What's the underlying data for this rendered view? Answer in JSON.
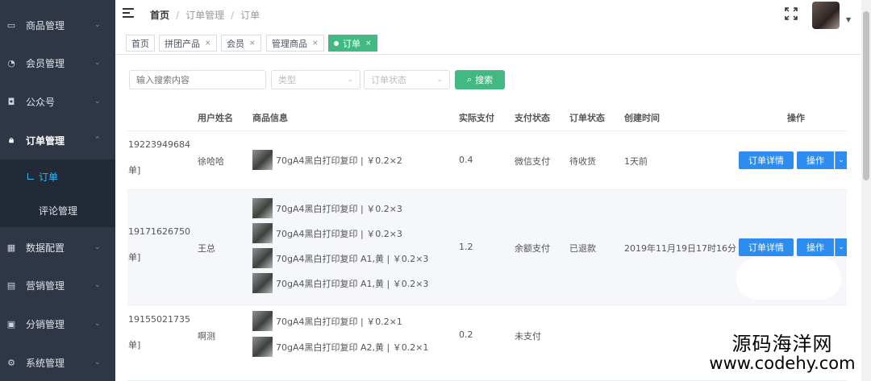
{
  "sidebar": {
    "items": [
      {
        "label": "商品管理",
        "icon": "bag-icon"
      },
      {
        "label": "会员管理",
        "icon": "user-icon"
      },
      {
        "label": "公众号",
        "icon": "wechat-icon"
      },
      {
        "label": "订单管理",
        "icon": "lock-icon"
      },
      {
        "label": "数据配置",
        "icon": "grid-icon"
      },
      {
        "label": "营销管理",
        "icon": "marketing-icon"
      },
      {
        "label": "分销管理",
        "icon": "distribution-icon"
      },
      {
        "label": "系统管理",
        "icon": "gear-icon"
      }
    ],
    "submenu": [
      {
        "label": "订单"
      },
      {
        "label": "评论管理"
      }
    ]
  },
  "header": {
    "breadcrumb": [
      "首页",
      "订单管理",
      "订单"
    ]
  },
  "tabs": [
    {
      "label": "首页"
    },
    {
      "label": "拼团产品"
    },
    {
      "label": "会员"
    },
    {
      "label": "管理商品"
    },
    {
      "label": "订单"
    }
  ],
  "filters": {
    "search_placeholder": "输入搜索内容",
    "type_placeholder": "类型",
    "status_placeholder": "订单状态",
    "search_button": "搜索"
  },
  "table": {
    "headers": [
      "用户姓名",
      "商品信息",
      "实际支付",
      "支付状态",
      "订单状态",
      "创建时间",
      "操作"
    ],
    "rows": [
      {
        "order_id": "19223949684",
        "order_suffix": "单]",
        "user": "徐哈哈",
        "goods": [
          "70gA4黑白打印复印 | ￥0.2×2"
        ],
        "paid": "0.4",
        "pay_status": "微信支付",
        "order_status": "待收货",
        "created": "1天前",
        "detail_btn": "订单详情",
        "op_btn": "操作"
      },
      {
        "order_id": "19171626750",
        "order_suffix": "单]",
        "user": "王总",
        "goods": [
          "70gA4黑白打印复印 | ￥0.2×3",
          "70gA4黑白打印复印 | ￥0.2×3",
          "70gA4黑白打印复印 A1,黄 | ￥0.2×3",
          "70gA4黑白打印复印 A1,黄 | ￥0.2×3"
        ],
        "paid": "1.2",
        "pay_status": "余额支付",
        "order_status": "已退款",
        "created": "2019年11月19日17时16分",
        "detail_btn": "订单详情",
        "op_btn": "操作"
      },
      {
        "order_id": "19155021735",
        "order_suffix": "单]",
        "user": "啊测",
        "goods": [
          "70gA4黑白打印复印 | ￥0.2×1",
          "70gA4黑白打印复印 A2,黄 | ￥0.2×1"
        ],
        "paid": "0.2",
        "pay_status": "未支付",
        "order_status": "",
        "created": ""
      }
    ]
  },
  "watermark": {
    "line1": "源码海洋网",
    "line2": "www.codehy.com"
  }
}
